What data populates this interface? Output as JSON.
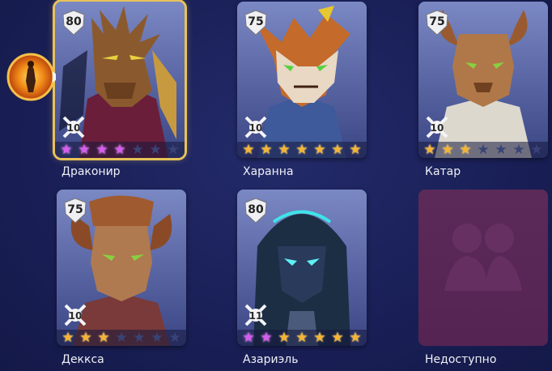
{
  "heroes": [
    {
      "name": "Драконир",
      "level": "80",
      "rank": "10",
      "stars": [
        "purple",
        "purple",
        "purple",
        "purple",
        "empty",
        "empty",
        "empty"
      ],
      "selected": true
    },
    {
      "name": "Харанна",
      "level": "75",
      "rank": "10",
      "stars": [
        "gold",
        "gold",
        "gold",
        "gold",
        "gold",
        "gold",
        "gold"
      ],
      "selected": false
    },
    {
      "name": "Катар",
      "level": "75",
      "rank": "10",
      "stars": [
        "gold",
        "gold",
        "gold",
        "empty",
        "empty",
        "empty",
        "empty"
      ],
      "selected": false
    },
    {
      "name": "Деккса",
      "level": "75",
      "rank": "10",
      "stars": [
        "gold",
        "gold",
        "gold",
        "empty",
        "empty",
        "empty",
        "empty"
      ],
      "selected": false
    },
    {
      "name": "Азариэль",
      "level": "80",
      "rank": "11",
      "stars": [
        "purple",
        "purple",
        "gold",
        "gold",
        "gold",
        "gold",
        "gold"
      ],
      "selected": false
    }
  ],
  "locked_slot": {
    "label": "Недоступно"
  },
  "colors": {
    "card": "#5a68ac",
    "locked": "#5a2856",
    "selected_border": "#e8c25a",
    "star_gold": "#f4b436",
    "star_purple": "#d65cf0"
  }
}
